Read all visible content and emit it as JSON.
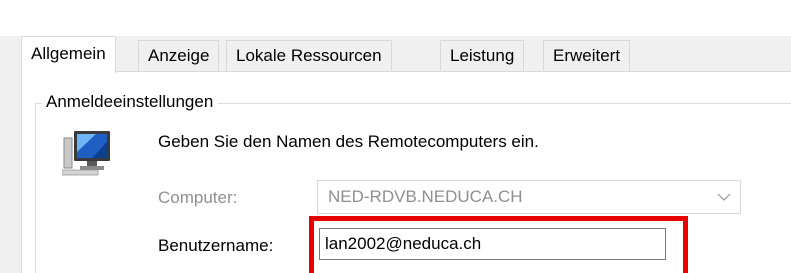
{
  "tabs": [
    {
      "label": "Allgemein",
      "active": true
    },
    {
      "label": "Anzeige",
      "active": false
    },
    {
      "label": "Lokale Ressourcen",
      "active": false
    },
    {
      "label": "Leistung",
      "active": false
    },
    {
      "label": "Erweitert",
      "active": false
    }
  ],
  "group": {
    "title": "Anmeldeeinstellungen",
    "icon": "remote-computer-icon",
    "description": "Geben Sie den Namen des Remotecomputers ein."
  },
  "computer": {
    "label": "Computer:",
    "value": "NED-RDVB.NEDUCA.CH",
    "enabled": false
  },
  "username": {
    "label": "Benutzername:",
    "value": "lan2002@neduca.ch"
  },
  "colors": {
    "highlight": "#e80000",
    "disabled_text": "#8f8f8f",
    "dialog_bg": "#f0f0f0"
  }
}
